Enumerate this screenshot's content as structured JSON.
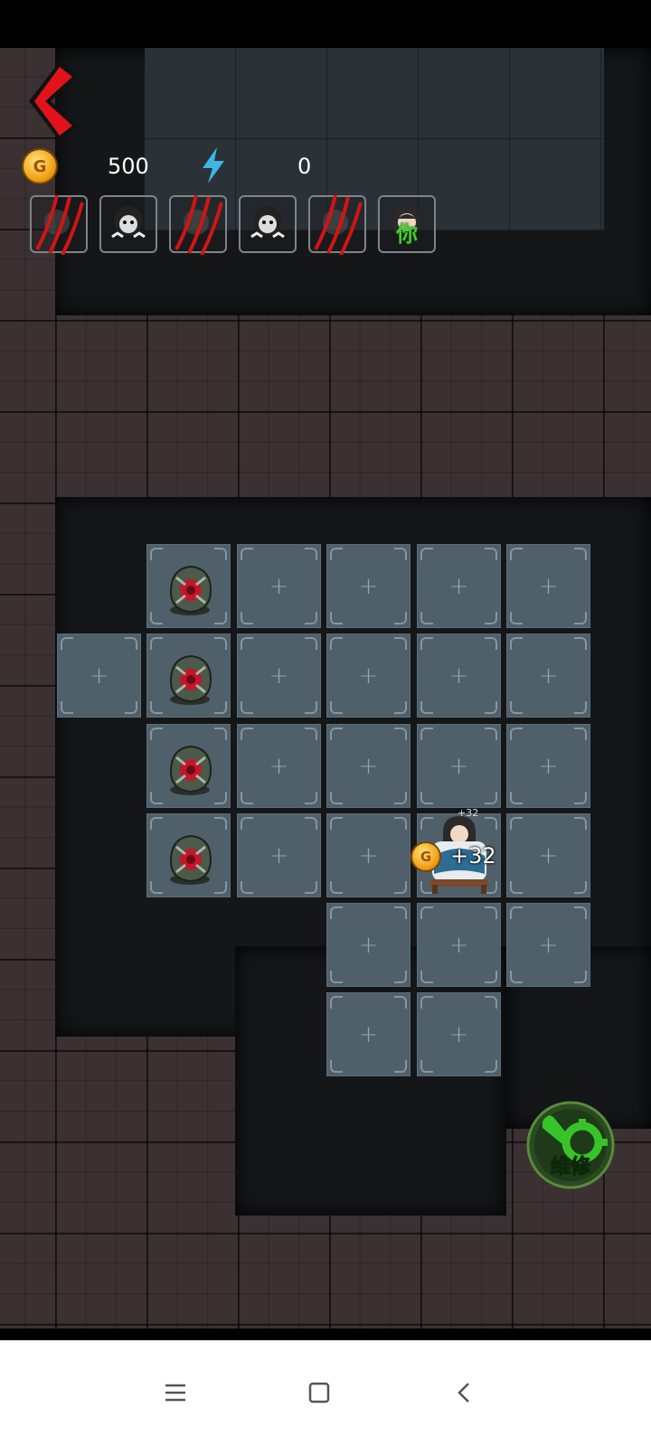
{
  "hud": {
    "gold_value": "500",
    "energy_value": "0",
    "coin_letter": "G"
  },
  "slots": [
    {
      "kind": "claw-marks"
    },
    {
      "kind": "ghost-portrait"
    },
    {
      "kind": "claw-marks"
    },
    {
      "kind": "ghost-portrait"
    },
    {
      "kind": "claw-marks"
    },
    {
      "kind": "player-portrait",
      "label": "你"
    }
  ],
  "board": {
    "plus_symbol": "+",
    "reward_text": "+32",
    "reward_small_text": "+32"
  },
  "repair_button": {
    "label": "维修"
  },
  "colors": {
    "back_arrow": "#e0141a",
    "energy_bolt": "#3fb4e6",
    "repair_green": "#38c428",
    "you_label": "#3fd12b"
  },
  "icons": {
    "back": "back-arrow-icon",
    "gold": "gold-coin-icon",
    "energy": "lightning-icon",
    "repair": "wrench-gear-icon",
    "nav_menu": "menu-icon",
    "nav_home": "home-square-icon",
    "nav_back": "back-chevron-icon"
  }
}
